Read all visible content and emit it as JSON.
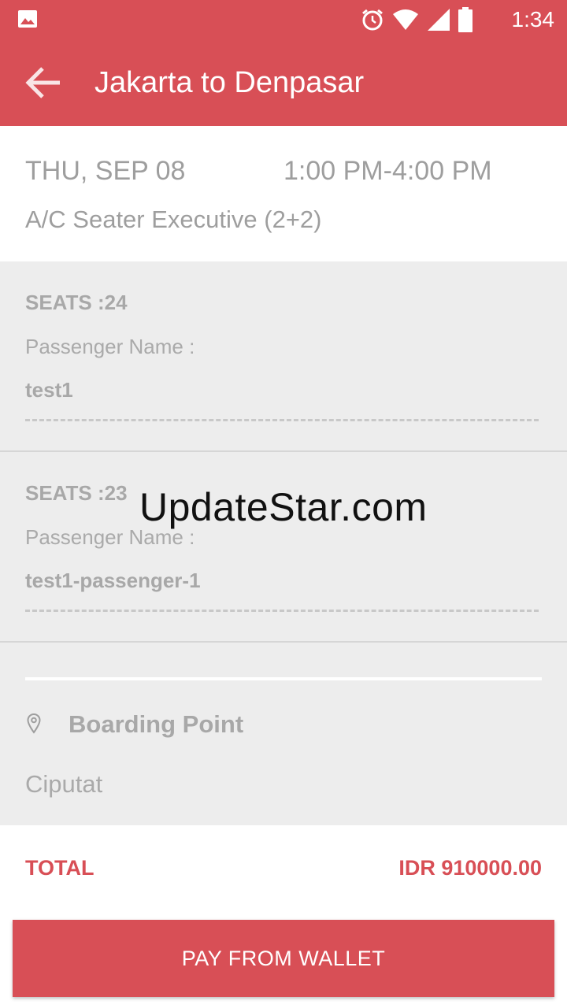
{
  "status_bar": {
    "time": "1:34",
    "icons": [
      "gallery-icon",
      "alarm-icon",
      "wifi-icon",
      "signal-icon",
      "battery-icon"
    ]
  },
  "app_bar": {
    "title": "Jakarta to Denpasar",
    "back_icon": "arrow-left-icon"
  },
  "trip": {
    "date": "THU, SEP 08",
    "time_range": "1:00 PM-4:00 PM",
    "bus_type": "A/C Seater Executive (2+2)"
  },
  "passengers": [
    {
      "seats": "SEATS :24",
      "name_label": "Passenger Name :",
      "name": "test1"
    },
    {
      "seats": "SEATS :23",
      "name_label": "Passenger Name :",
      "name": "test1-passenger-1"
    }
  ],
  "boarding": {
    "label": "Boarding Point",
    "value": "Ciputat",
    "icon": "location-pin-icon"
  },
  "watermark": "UpdateStar.com",
  "total": {
    "label": "TOTAL",
    "value": "IDR 910000.00"
  },
  "pay_button": {
    "label": "PAY FROM WALLET"
  },
  "colors": {
    "accent": "#d84f56",
    "background_gray": "#ededed",
    "text_gray": "#9e9e9e"
  }
}
